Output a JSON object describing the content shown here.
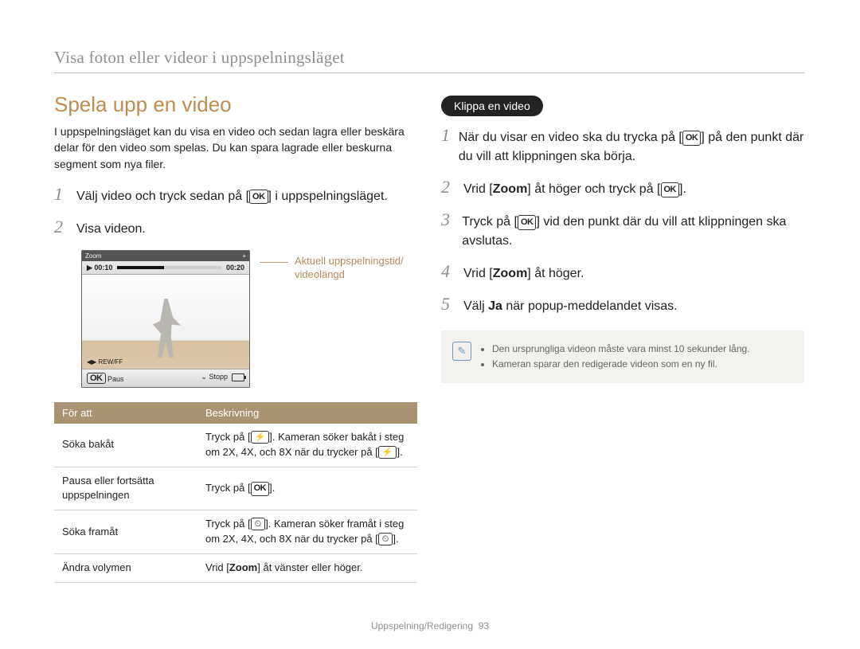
{
  "header": {
    "breadcrumb": "Visa foton eller videor i uppspelningsläget"
  },
  "left": {
    "title": "Spela upp en video",
    "intro": "I uppspelningsläget kan du visa en video och sedan lagra eller beskära delar för den video som spelas. Du kan spara lagrade eller beskurna segment som nya filer.",
    "steps": [
      {
        "num": "1",
        "before": "Välj video och tryck sedan på [",
        "icon": "ok",
        "after": "] i uppspelningsläget."
      },
      {
        "num": "2",
        "before": "Visa videon.",
        "icon": "",
        "after": ""
      }
    ],
    "preview": {
      "zoom_label": "Zoom",
      "time_current": "00:10",
      "time_total": "00:20",
      "rewff": "REW/FF",
      "pause_icon_label": "OK",
      "pause_label": "Paus",
      "stop_label": "Stopp",
      "leader_label": "Aktuell uppspelningstid/\nvideolängd"
    },
    "table": {
      "head_left": "För att",
      "head_right": "Beskrivning",
      "rows": [
        {
          "action": "Söka bakåt",
          "desc_parts": [
            "Tryck på [",
            "flash",
            "]. Kameran söker bakåt i steg om 2X, 4X, och 8X när du trycker på [",
            "flash",
            "]."
          ]
        },
        {
          "action": "Pausa eller fortsätta uppspelningen",
          "desc_parts": [
            "Tryck på [",
            "ok",
            "]."
          ]
        },
        {
          "action": "Söka framåt",
          "desc_parts": [
            "Tryck på [",
            "timer",
            "]. Kameran söker framåt i steg om 2X, 4X, och 8X när du trycker på [",
            "timer",
            "]."
          ]
        },
        {
          "action": "Ändra volymen",
          "desc_parts": [
            "Vrid [",
            "bold:Zoom",
            "] åt vänster eller höger."
          ]
        }
      ]
    }
  },
  "right": {
    "pill": "Klippa en video",
    "steps": [
      {
        "num": "1",
        "parts": [
          "När du visar en video ska du trycka på [",
          "ok",
          "] på den punkt där du vill att klippningen ska börja."
        ]
      },
      {
        "num": "2",
        "parts": [
          "Vrid [",
          "bold:Zoom",
          "] åt höger och tryck på [",
          "ok",
          "]."
        ]
      },
      {
        "num": "3",
        "parts": [
          "Tryck på [",
          "ok",
          "] vid den punkt där du vill att klippningen ska avslutas."
        ]
      },
      {
        "num": "4",
        "parts": [
          "Vrid [",
          "bold:Zoom",
          "] åt höger."
        ]
      },
      {
        "num": "5",
        "parts": [
          "Välj ",
          "bold:Ja",
          " när popup-meddelandet visas."
        ]
      }
    ],
    "notes": [
      "Den ursprungliga videon måste vara minst 10 sekunder lång.",
      "Kameran sparar den redigerade videon som en ny fil."
    ]
  },
  "footer": {
    "section": "Uppspelning/Redigering",
    "page": "93"
  }
}
